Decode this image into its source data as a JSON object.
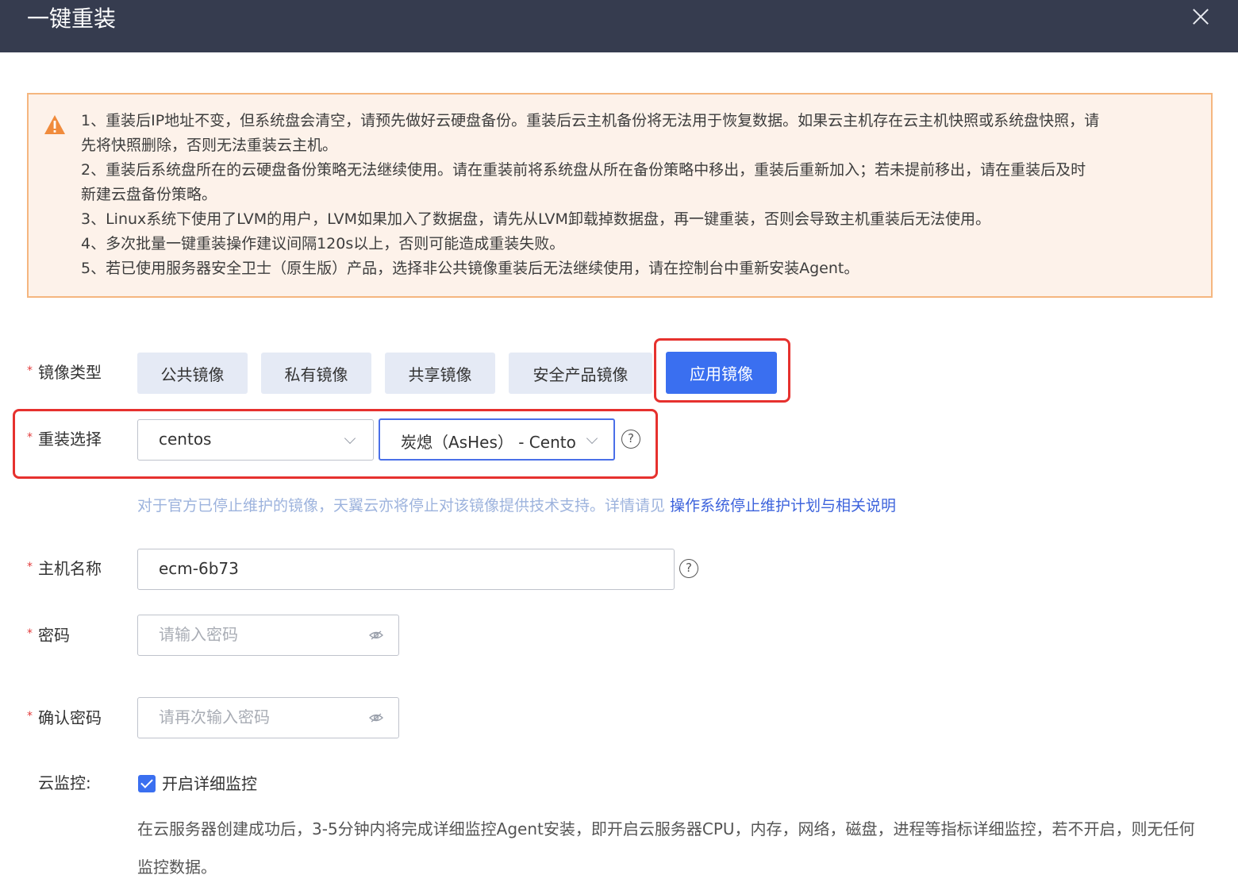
{
  "dialog": {
    "title": "一键重装"
  },
  "notice": {
    "lines": [
      "1、重装后IP地址不变，但系统盘会清空，请预先做好云硬盘备份。重装后云主机备份将无法用于恢复数据。如果云主机存在云主机快照或系统盘快照，请",
      "先将快照删除，否则无法重装云主机。",
      "2、重装后系统盘所在的云硬盘备份策略无法继续使用。请在重装前将系统盘从所在备份策略中移出，重装后重新加入；若未提前移出，请在重装后及时",
      "新建云盘备份策略。",
      "3、Linux系统下使用了LVM的用户，LVM如果加入了数据盘，请先从LVM卸载掉数据盘，再一键重装，否则会导致主机重装后无法使用。",
      "4、多次批量一键重装操作建议间隔120s以上，否则可能造成重装失败。",
      "5、若已使用服务器安全卫士（原生版）产品，选择非公共镜像重装后无法继续使用，请在控制台中重新安装Agent。"
    ]
  },
  "form": {
    "image_type": {
      "label": "镜像类型",
      "options": [
        "公共镜像",
        "私有镜像",
        "共享镜像",
        "安全产品镜像",
        "应用镜像"
      ],
      "selected": "应用镜像"
    },
    "reinstall": {
      "label": "重装选择",
      "os_value": "centos",
      "image_value": "炭熄（AsHes）  - Centos"
    },
    "hint": {
      "text": "对于官方已停止维护的镜像，天翼云亦将停止对该镜像提供技术支持。详情请见 ",
      "link": "操作系统停止维护计划与相关说明"
    },
    "hostname": {
      "label": "主机名称",
      "value": "ecm-6b73"
    },
    "password": {
      "label": "密码",
      "placeholder": "请输入密码"
    },
    "confirm_password": {
      "label": "确认密码",
      "placeholder": "请再次输入密码"
    },
    "monitor": {
      "label": "云监控:",
      "checkbox_label": "开启详细监控",
      "checked": true,
      "description": "在云服务器创建成功后，3-5分钟内将完成详细监控Agent安装，即开启云服务器CPU，内存，网络，磁盘，进程等指标详细监控，若不开启，则无任何监控数据。"
    }
  },
  "colors": {
    "header_bg": "#363c4f",
    "primary": "#3a6ff0",
    "notice_bg": "#fdf2ea",
    "notice_border": "#f5b67f",
    "highlight_frame": "#e6312e"
  }
}
